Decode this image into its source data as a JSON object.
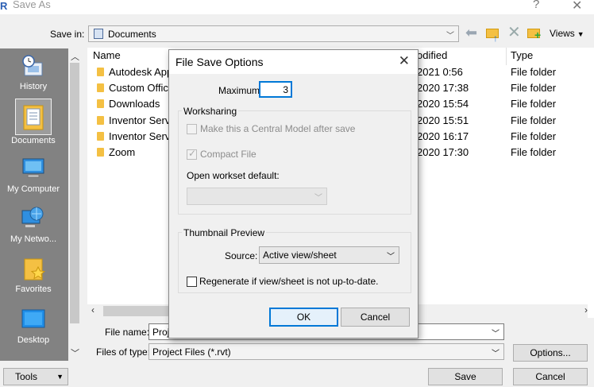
{
  "window": {
    "app_letter": "R",
    "title": "Save As",
    "help_symbol": "?",
    "close_symbol": "✕"
  },
  "toolbar": {
    "save_in_label": "Save in:",
    "save_in_value": "Documents",
    "views_label": "Views"
  },
  "places": [
    {
      "label": "History",
      "icon": "history-icon"
    },
    {
      "label": "Documents",
      "icon": "documents-icon",
      "selected": true
    },
    {
      "label": "My Computer",
      "icon": "computer-icon"
    },
    {
      "label": "My Netwo...",
      "icon": "network-icon"
    },
    {
      "label": "Favorites",
      "icon": "star-folder-icon"
    },
    {
      "label": "Desktop",
      "icon": "desktop-icon"
    }
  ],
  "filelist": {
    "columns": {
      "name": "Name",
      "modified": "odified",
      "type": "Type"
    },
    "rows": [
      {
        "name": "Autodesk App",
        "modified": "2021 0:56",
        "type": "File folder"
      },
      {
        "name": "Custom Office",
        "modified": "2020 17:38",
        "type": "File folder"
      },
      {
        "name": "Downloads",
        "modified": "2020 15:54",
        "type": "File folder"
      },
      {
        "name": "Inventor Serve",
        "modified": "2020 15:51",
        "type": "File folder"
      },
      {
        "name": "Inventor Serve",
        "modified": "2020 16:17",
        "type": "File folder"
      },
      {
        "name": "Zoom",
        "modified": "2020 17:30",
        "type": "File folder"
      }
    ]
  },
  "bottom": {
    "file_name_label": "File name:",
    "file_name_value": "Proj",
    "file_type_label": "Files of type:",
    "file_type_value": "Project Files  (*.rvt)",
    "options_label": "Options...",
    "tools_label": "Tools",
    "save_label": "Save",
    "cancel_label": "Cancel"
  },
  "modal": {
    "title": "File Save Options",
    "maximum_label": "Maximum",
    "maximum_value": "3",
    "worksharing_label": "Worksharing",
    "central_model_label": "Make this a Central Model after save",
    "central_model_checked": false,
    "compact_file_label": "Compact File",
    "compact_file_checked": true,
    "open_workset_label": "Open workset default:",
    "open_workset_value": "",
    "thumbnail_label": "Thumbnail Preview",
    "source_label": "Source:",
    "source_value": "Active view/sheet",
    "regenerate_label": "Regenerate if view/sheet is not up-to-date.",
    "regenerate_checked": false,
    "ok_label": "OK",
    "cancel_label": "Cancel"
  }
}
